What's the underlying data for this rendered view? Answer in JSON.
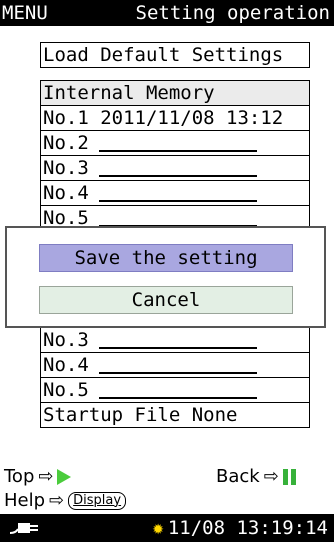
{
  "header": {
    "menu_label": "MENU",
    "title": "Setting operation"
  },
  "load_default": {
    "label": "Load Default Settings"
  },
  "memory": {
    "header": "Internal Memory",
    "first_entry": "No.1 2011/11/08 13:12",
    "slots_top": [
      "No.2",
      "No.3",
      "No.4",
      "No.5"
    ],
    "slots_bottom": [
      "No.3",
      "No.4",
      "No.5"
    ]
  },
  "startup_file": "Startup File None",
  "dialog": {
    "save_label": "Save the setting",
    "cancel_label": "Cancel"
  },
  "footer": {
    "top_label": "Top",
    "back_label": "Back",
    "help_label": "Help",
    "arrow": "⇨",
    "display_key": "Display"
  },
  "status": {
    "datetime": "11/08 13:19:14",
    "icons": [
      "plug-icon",
      "lamp-icon"
    ]
  }
}
